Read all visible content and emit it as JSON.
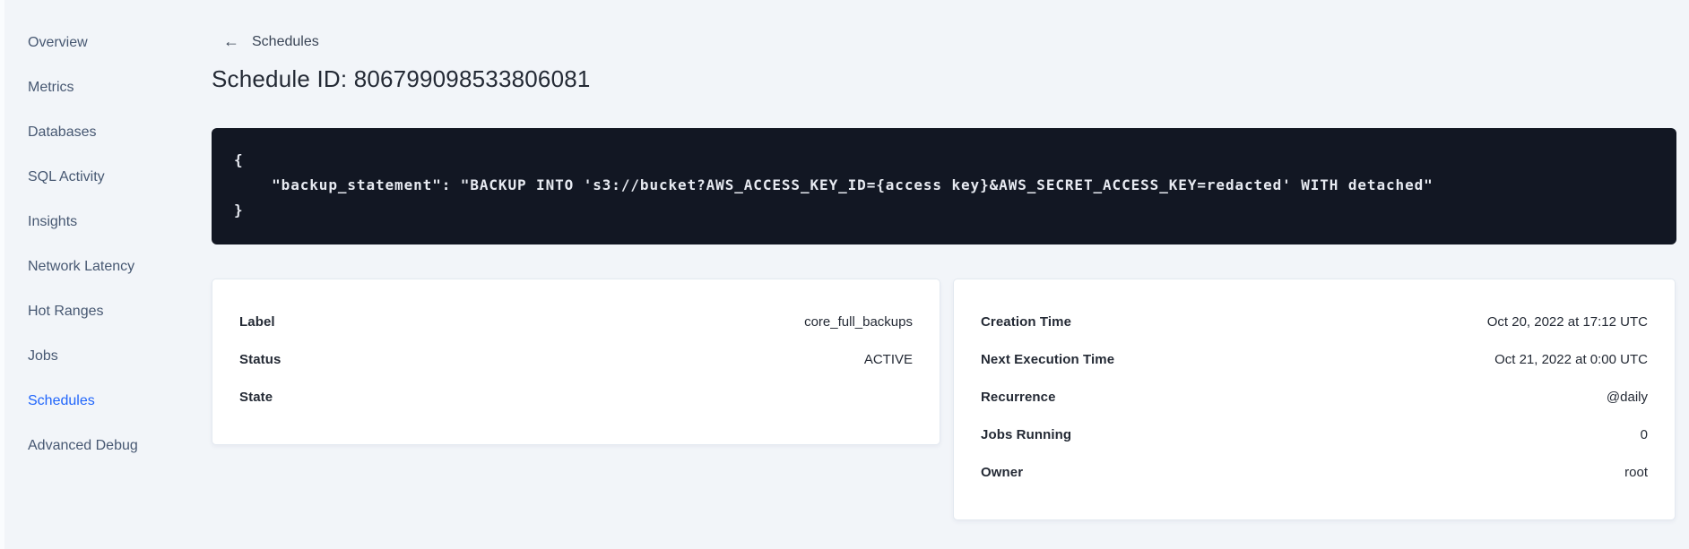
{
  "sidebar": {
    "items": [
      {
        "label": "Overview",
        "active": false
      },
      {
        "label": "Metrics",
        "active": false
      },
      {
        "label": "Databases",
        "active": false
      },
      {
        "label": "SQL Activity",
        "active": false
      },
      {
        "label": "Insights",
        "active": false
      },
      {
        "label": "Network Latency",
        "active": false
      },
      {
        "label": "Hot Ranges",
        "active": false
      },
      {
        "label": "Jobs",
        "active": false
      },
      {
        "label": "Schedules",
        "active": true
      },
      {
        "label": "Advanced Debug",
        "active": false
      }
    ]
  },
  "header": {
    "back_icon": "←",
    "back_label": "Schedules",
    "title": "Schedule ID: 806799098533806081"
  },
  "code_block": {
    "lines": [
      "{",
      "    \"backup_statement\": \"BACKUP INTO 's3://bucket?AWS_ACCESS_KEY_ID={access key}&AWS_SECRET_ACCESS_KEY=redacted' WITH detached\"",
      "}"
    ]
  },
  "details_card": {
    "rows": [
      {
        "label": "Label",
        "value": "core_full_backups"
      },
      {
        "label": "Status",
        "value": "ACTIVE"
      },
      {
        "label": "State",
        "value": ""
      }
    ]
  },
  "schedule_card": {
    "rows": [
      {
        "label": "Creation Time",
        "value": "Oct 20, 2022 at 17:12 UTC"
      },
      {
        "label": "Next Execution Time",
        "value": "Oct 21, 2022 at 0:00 UTC"
      },
      {
        "label": "Recurrence",
        "value": "@daily"
      },
      {
        "label": "Jobs Running",
        "value": "0"
      },
      {
        "label": "Owner",
        "value": "root"
      }
    ]
  },
  "colors": {
    "page_bg": "#f2f5f9",
    "code_bg": "#121723",
    "accent_blue": "#2065fb",
    "text_dark": "#242a35",
    "sidebar_text": "#475872"
  }
}
